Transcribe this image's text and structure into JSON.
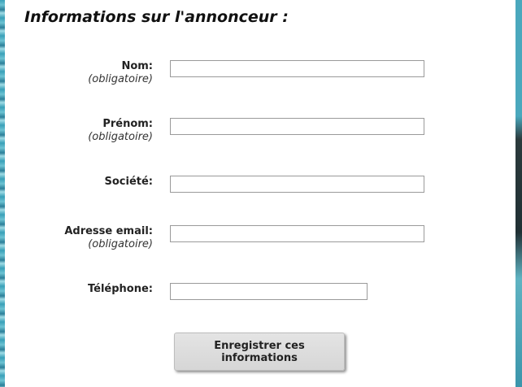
{
  "form": {
    "title": "Informations sur l'annonceur :",
    "fields": [
      {
        "label": "Nom:",
        "required": "(obligatoire)",
        "value": ""
      },
      {
        "label": "Prénom:",
        "required": "(obligatoire)",
        "value": ""
      },
      {
        "label": "Société:",
        "value": ""
      },
      {
        "label": "Adresse email:",
        "required": "(obligatoire)",
        "value": ""
      },
      {
        "label": "Téléphone:",
        "value": ""
      }
    ],
    "submit_label": "Enregistrer ces informations"
  }
}
